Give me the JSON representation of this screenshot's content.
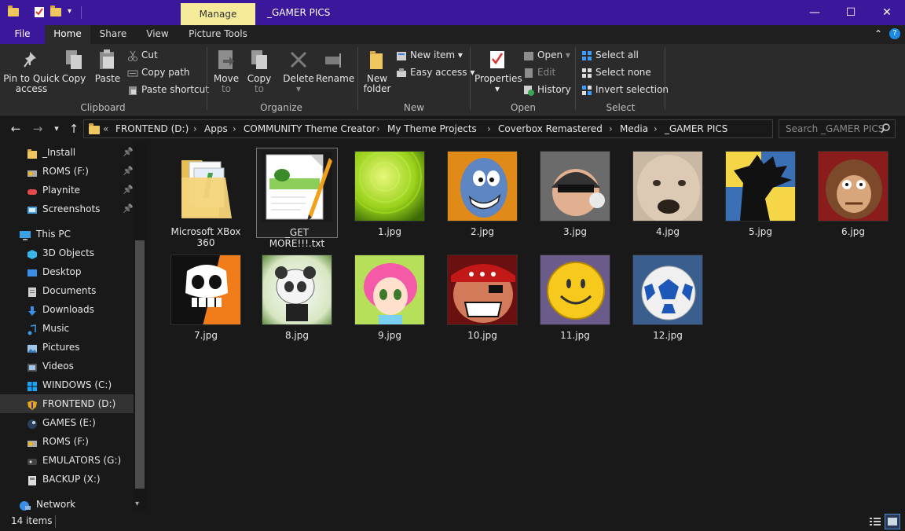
{
  "window": {
    "title": "_GAMER PICS",
    "manage_tab": "Manage",
    "minimize": "—",
    "maximize": "☐",
    "close": "✕"
  },
  "tabs": {
    "file": "File",
    "home": "Home",
    "share": "Share",
    "view": "View",
    "picture_tools": "Picture Tools",
    "collapse": "⌃",
    "help": "?"
  },
  "ribbon": {
    "clipboard": {
      "label": "Clipboard",
      "pin_line1": "Pin to Quick",
      "pin_line2": "access",
      "copy": "Copy",
      "paste": "Paste",
      "cut": "Cut",
      "copy_path": "Copy path",
      "paste_shortcut": "Paste shortcut"
    },
    "organize": {
      "label": "Organize",
      "move_line1": "Move",
      "move_line2": "to",
      "copy_line1": "Copy",
      "copy_line2": "to",
      "delete": "Delete",
      "rename": "Rename"
    },
    "new": {
      "label": "New",
      "folder_line1": "New",
      "folder_line2": "folder",
      "new_item": "New item",
      "easy_access": "Easy access"
    },
    "open": {
      "label": "Open",
      "properties": "Properties",
      "open": "Open",
      "edit": "Edit",
      "history": "History"
    },
    "select": {
      "label": "Select",
      "select_all": "Select all",
      "select_none": "Select none",
      "invert": "Invert selection"
    }
  },
  "address": {
    "overflow": "«",
    "crumbs": [
      "FRONTEND (D:)",
      "Apps",
      "COMMUNITY Theme Creator",
      "My Theme Projects",
      "Coverbox Remastered",
      "Media",
      "_GAMER PICS"
    ],
    "separator": "›",
    "search_placeholder": "Search _GAMER PICS"
  },
  "nav": {
    "quick": [
      {
        "label": "_Install",
        "pinned": true
      },
      {
        "label": "ROMS (F:)",
        "pinned": true
      },
      {
        "label": "Playnite",
        "pinned": true
      },
      {
        "label": "Screenshots",
        "pinned": true
      }
    ],
    "this_pc": "This PC",
    "pc_items": [
      "3D Objects",
      "Desktop",
      "Documents",
      "Downloads",
      "Music",
      "Pictures",
      "Videos",
      "WINDOWS (C:)",
      "FRONTEND (D:)",
      "GAMES (E:)",
      "ROMS (F:)",
      "EMULATORS (G:)",
      "BACKUP (X:)"
    ],
    "network": "Network",
    "selected": "FRONTEND (D:)"
  },
  "files": [
    {
      "name": "Microsoft XBox 360",
      "kind": "folder"
    },
    {
      "name": "_GET MORE!!!.txt",
      "kind": "text"
    },
    {
      "name": "1.jpg",
      "kind": "image"
    },
    {
      "name": "2.jpg",
      "kind": "image"
    },
    {
      "name": "3.jpg",
      "kind": "image"
    },
    {
      "name": "4.jpg",
      "kind": "image"
    },
    {
      "name": "5.jpg",
      "kind": "image"
    },
    {
      "name": "6.jpg",
      "kind": "image"
    },
    {
      "name": "7.jpg",
      "kind": "image"
    },
    {
      "name": "8.jpg",
      "kind": "image"
    },
    {
      "name": "9.jpg",
      "kind": "image"
    },
    {
      "name": "10.jpg",
      "kind": "image"
    },
    {
      "name": "11.jpg",
      "kind": "image"
    },
    {
      "name": "12.jpg",
      "kind": "image"
    }
  ],
  "status": {
    "count": "14 items"
  },
  "colors": {
    "accent": "#3b179c",
    "manage": "#f5eb9b",
    "background": "#191919",
    "ribbon": "#2b2b2b"
  }
}
